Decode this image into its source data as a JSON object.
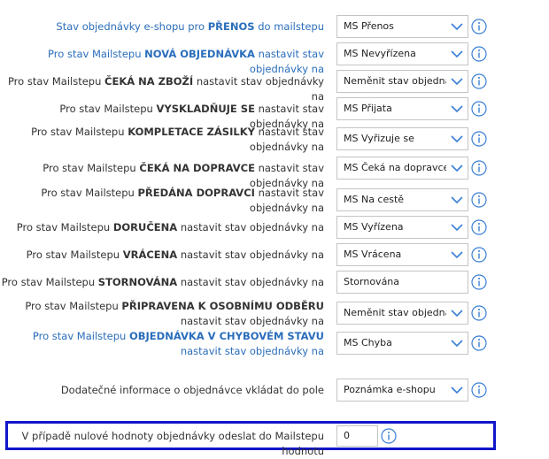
{
  "rows": [
    {
      "label": {
        "pre": "Stav objednávky e-shopu pro ",
        "bold": "PŘENOS",
        "post": " do mailstepu"
      },
      "value": "MS  Přenos"
    },
    {
      "label": {
        "pre": "Pro stav Mailstepu ",
        "bold": "NOVÁ OBJEDNÁVKA",
        "post": " nastavit stav objednávky na"
      },
      "value": "MS  Nevyřízena"
    },
    {
      "label": {
        "pre": "Pro stav Mailstepu ",
        "bold": "ČEKÁ NA ZBOŽÍ",
        "post": " nastavit stav objednávky na"
      },
      "value": "Neměnit stav objednávky"
    },
    {
      "label": {
        "pre": "Pro stav Mailstepu ",
        "bold": "VYSKLADŇUJE SE",
        "post": " nastavit stav objednávky na"
      },
      "value": "MS  Přijata"
    },
    {
      "label": {
        "pre": "Pro stav Mailstepu ",
        "bold": "KOMPLETACE ZÁSILKY",
        "post": " nastavit stav objednávky na"
      },
      "value": "MS  Vyřizuje se"
    },
    {
      "label": {
        "pre": "Pro stav Mailstepu ",
        "bold": "ČEKÁ NA DOPRAVCE",
        "post": " nastavit stav objednávky na"
      },
      "value": "MS  Čeká na dopravce"
    },
    {
      "label": {
        "pre": "Pro stav Mailstepu ",
        "bold": "PŘEDÁNA DOPRAVCI",
        "post": " nastavit stav objednávky na"
      },
      "value": "MS  Na cestě"
    },
    {
      "label": {
        "pre": "Pro stav Mailstepu ",
        "bold": "DORUČENA",
        "post": " nastavit stav objednávky na"
      },
      "value": "MS  Vyřízena"
    },
    {
      "label": {
        "pre": "Pro stav Mailstepu ",
        "bold": "VRÁCENA",
        "post": " nastavit stav objednávky na"
      },
      "value": "MS  Vrácena"
    },
    {
      "label": {
        "pre": "Pro stav Mailstepu ",
        "bold": "STORNOVÁNA",
        "post": " nastavit stav objednávky na"
      },
      "value": "Stornována"
    },
    {
      "label": {
        "pre": "Pro stav Mailstepu ",
        "bold": "PŘIPRAVENA K OSOBNÍMU ODBĚRU",
        "post": " nastavit stav objednávky na"
      },
      "value": "Neměnit stav objednávky"
    },
    {
      "label": {
        "pre": "Pro stav Mailstepu ",
        "bold": "OBJEDNÁVKA V CHYBOVÉM STAVU",
        "post": " nastavit stav objednávky na"
      },
      "value": "MS  Chyba"
    }
  ],
  "extra_info": {
    "label": "Dodatečné informace o objednávce vkládat do pole",
    "value": "Poznámka e-shopu"
  },
  "zero_value": {
    "label": "V případě nulové hodnoty objednávky odeslat do Mailstepu hodnotu",
    "value": "0"
  },
  "colors": {
    "link_blue": "#2a6ebb",
    "icon_blue": "#3a7fd5",
    "highlight": "#1116c9"
  }
}
